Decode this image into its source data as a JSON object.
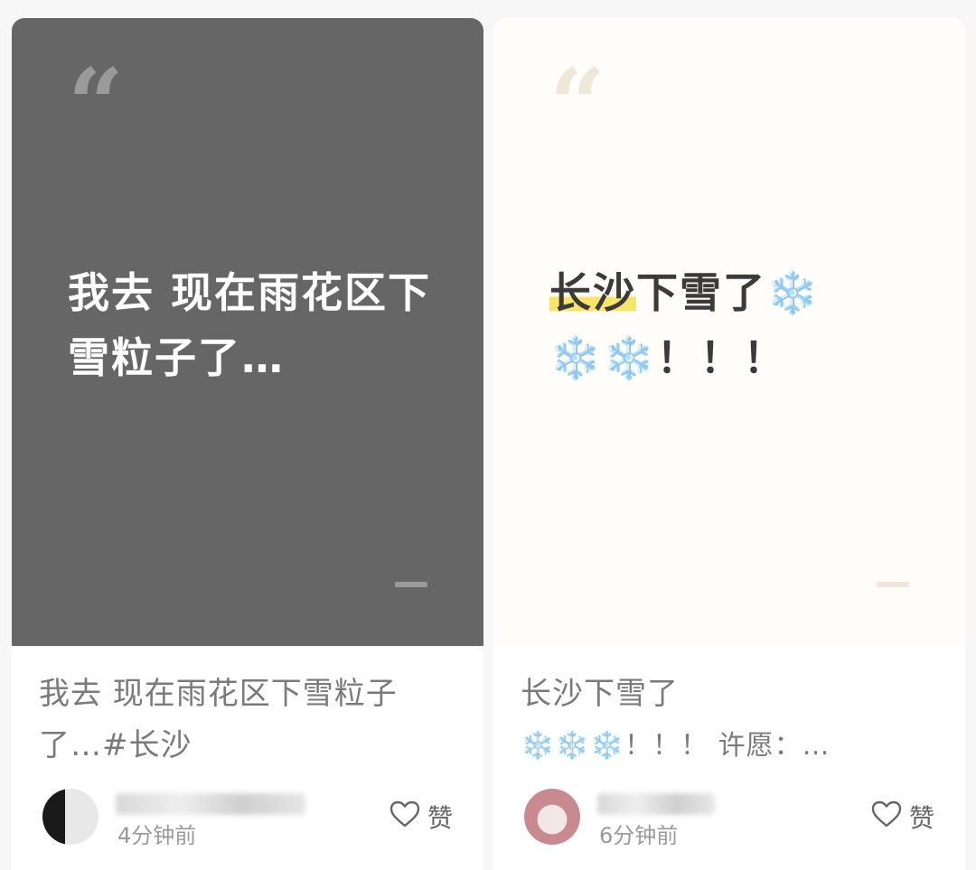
{
  "cards": [
    {
      "cover": {
        "quote_mark": "“",
        "text": "我去 现在雨花区下雪粒子了…"
      },
      "caption": {
        "line1": "我去 现在雨花区下雪粒子",
        "line2": "了…#长沙"
      },
      "time": "4分钟前",
      "like_label": "赞",
      "like_icon": "heart-outline-icon"
    },
    {
      "cover": {
        "quote_mark": "“",
        "text_highlight": "长沙",
        "text_rest_line1": "下雪了❄️",
        "text_line2": "❄️❄️！！！"
      },
      "caption": {
        "line1": "长沙下雪了",
        "line2": "❄️❄️❄️！！！ 许愿：…"
      },
      "time": "6分钟前",
      "like_label": "赞",
      "like_icon": "heart-outline-icon"
    }
  ],
  "colors": {
    "dark_cover": "#666666",
    "light_cover": "#fffdf9",
    "highlight": "#f7e46b"
  }
}
